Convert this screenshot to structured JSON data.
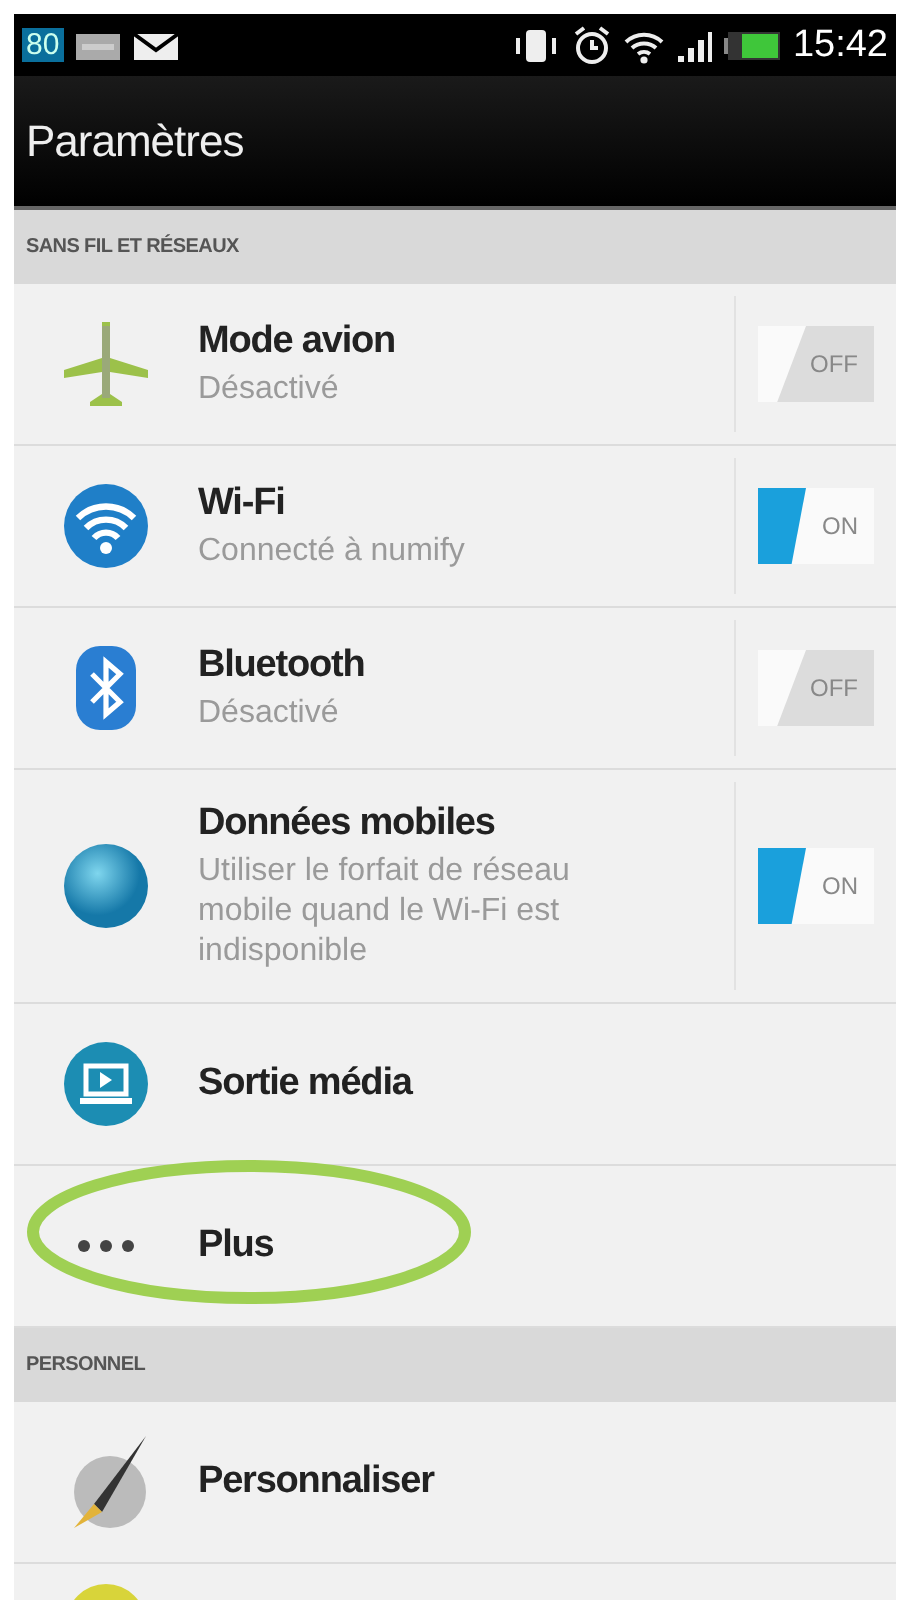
{
  "status_bar": {
    "badge": "80",
    "time": "15:42"
  },
  "title_bar": {
    "title": "Paramètres"
  },
  "sections": [
    {
      "header": "SANS FIL ET RÉSEAUX",
      "rows": [
        {
          "kind": "toggle",
          "title": "Mode avion",
          "subtitle": "Désactivé",
          "toggle": {
            "on": false,
            "label": "OFF"
          },
          "highlighted": false
        },
        {
          "kind": "toggle",
          "title": "Wi-Fi",
          "subtitle": "Connecté à numify",
          "toggle": {
            "on": true,
            "label": "ON"
          },
          "highlighted": false
        },
        {
          "kind": "toggle",
          "title": "Bluetooth",
          "subtitle": "Désactivé",
          "toggle": {
            "on": false,
            "label": "OFF"
          },
          "highlighted": false
        },
        {
          "kind": "toggle",
          "title": "Données mobiles",
          "subtitle": "Utiliser le forfait de réseau mobile quand le Wi-Fi est indisponible",
          "toggle": {
            "on": true,
            "label": "ON"
          },
          "highlighted": false
        },
        {
          "kind": "plain",
          "title": "Sortie média",
          "highlighted": false
        },
        {
          "kind": "plain",
          "title": "Plus",
          "highlighted": true
        }
      ]
    },
    {
      "header": "PERSONNEL",
      "rows": [
        {
          "kind": "plain",
          "title": "Personnaliser",
          "highlighted": false
        },
        {
          "kind": "partial"
        }
      ]
    }
  ]
}
